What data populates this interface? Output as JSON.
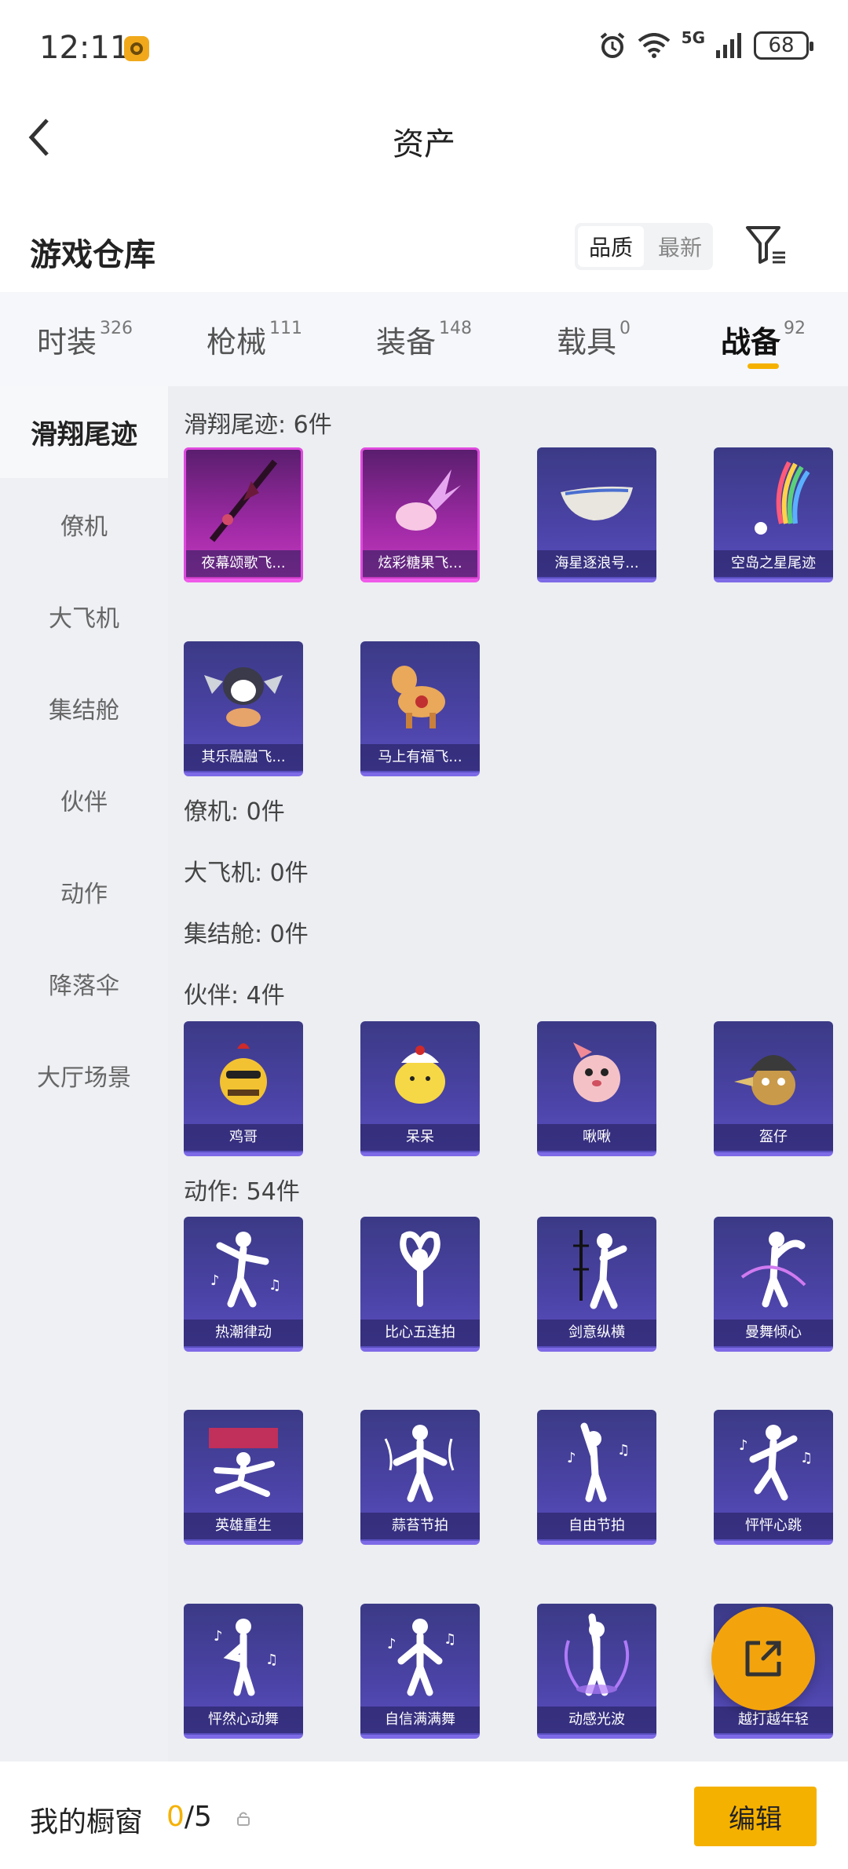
{
  "status": {
    "time": "12:11",
    "network": "5G",
    "battery": "68"
  },
  "header": {
    "title": "资产"
  },
  "section": {
    "title": "游戏仓库",
    "sort_quality": "品质",
    "sort_latest": "最新"
  },
  "tabs": [
    {
      "label": "时装",
      "count": "326"
    },
    {
      "label": "枪械",
      "count": "111"
    },
    {
      "label": "装备",
      "count": "148"
    },
    {
      "label": "载具",
      "count": "0"
    },
    {
      "label": "战备",
      "count": "92"
    }
  ],
  "sidebar": [
    "滑翔尾迹",
    "僚机",
    "大飞机",
    "集结舱",
    "伙伴",
    "动作",
    "降落伞",
    "大厅场景"
  ],
  "sections": {
    "trail": "滑翔尾迹: 6件",
    "wingman": "僚机: 0件",
    "plane": "大飞机: 0件",
    "pod": "集结舱: 0件",
    "partner": "伙伴: 4件",
    "emote": "动作: 54件"
  },
  "trail_items": [
    "夜幕颂歌飞...",
    "炫彩糖果飞...",
    "海星逐浪号...",
    "空岛之星尾迹",
    "其乐融融飞...",
    "马上有福飞..."
  ],
  "partner_items": [
    "鸡哥",
    "呆呆",
    "啾啾",
    "盔仔"
  ],
  "emote_items": [
    "热潮律动",
    "比心五连拍",
    "剑意纵横",
    "曼舞倾心",
    "英雄重生",
    "蒜苔节拍",
    "自由节拍",
    "怦怦心跳",
    "怦然心动舞",
    "自信满满舞",
    "动感光波",
    "越打越年轻"
  ],
  "bottom": {
    "showcase_label": "我的橱窗",
    "current": "0",
    "total": "/5",
    "edit": "编辑"
  }
}
